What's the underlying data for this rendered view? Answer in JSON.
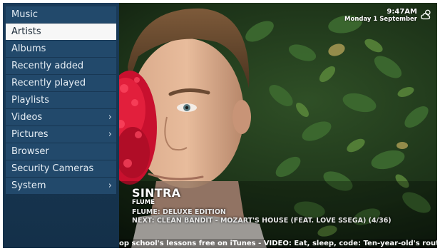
{
  "menu": {
    "items": [
      {
        "label": "Music",
        "has_submenu": false,
        "selected": false
      },
      {
        "label": "Artists",
        "has_submenu": false,
        "selected": true
      },
      {
        "label": "Albums",
        "has_submenu": false,
        "selected": false
      },
      {
        "label": "Recently added",
        "has_submenu": false,
        "selected": false
      },
      {
        "label": "Recently played",
        "has_submenu": false,
        "selected": false
      },
      {
        "label": "Playlists",
        "has_submenu": false,
        "selected": false
      },
      {
        "label": "Videos",
        "has_submenu": true,
        "selected": false
      },
      {
        "label": "Pictures",
        "has_submenu": true,
        "selected": false
      },
      {
        "label": "Browser",
        "has_submenu": false,
        "selected": false
      },
      {
        "label": "Security Cameras",
        "has_submenu": false,
        "selected": false
      },
      {
        "label": "System",
        "has_submenu": true,
        "selected": false
      }
    ],
    "chevron": "›"
  },
  "clock": {
    "time": "9:47AM",
    "date": "Monday 1 September",
    "weather_icon": "cloud-sun-icon"
  },
  "now_playing": {
    "title": "SINTRA",
    "artist": "FLUME",
    "album": "FLUME: DELUXE EDITION",
    "next": "NEXT: CLEAN BANDIT - MOZART'S HOUSE (FEAT. LOVE SSEGA) (4/36)"
  },
  "ticker": {
    "text": "op school's lessons free on iTunes - VIDEO: Eat, sleep, code: Ten-year-old's routine - MSN M"
  },
  "colors": {
    "menu_bg": "#22496b",
    "menu_selected_bg": "#f7f7f7",
    "sidebar_bg": "#173651"
  }
}
